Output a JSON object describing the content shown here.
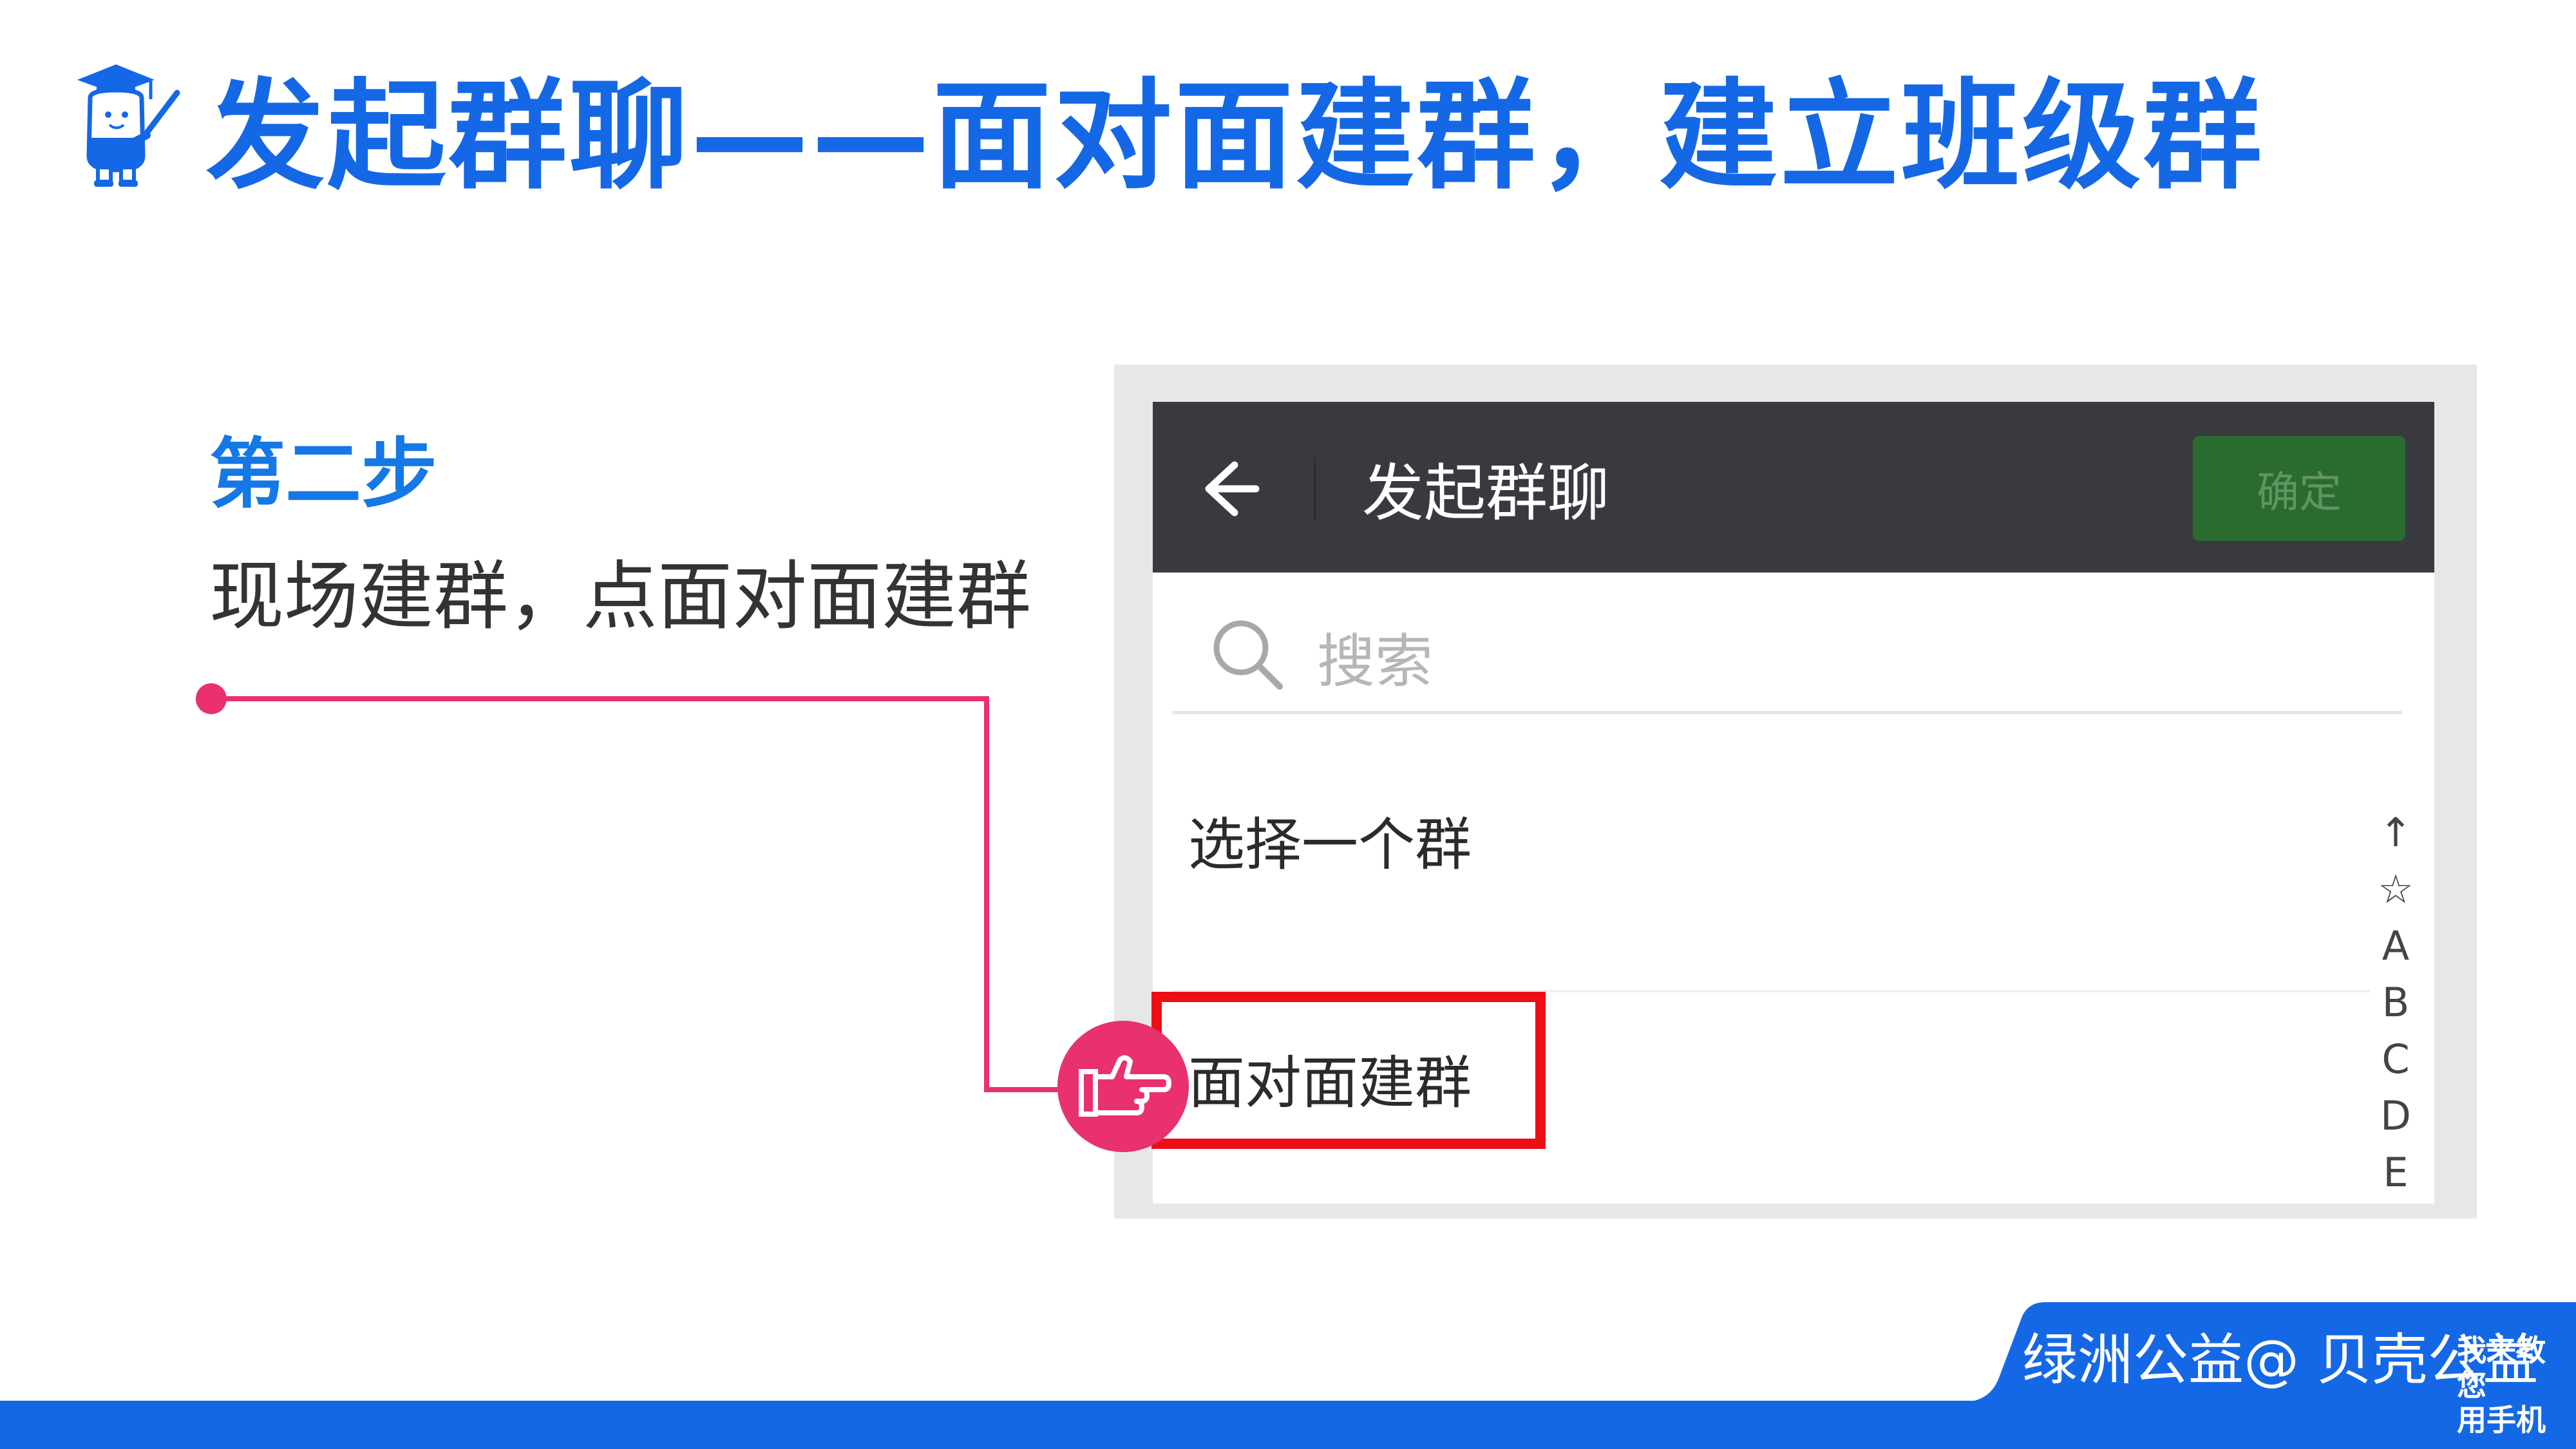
{
  "slide": {
    "title": "发起群聊——面对面建群，建立班级群",
    "step_title": "第二步",
    "step_description": "现场建群，点面对面建群"
  },
  "phone": {
    "appbar": {
      "back_icon": "arrow-left-icon",
      "title": "发起群聊",
      "confirm_label": "确定"
    },
    "search": {
      "icon": "search-icon",
      "placeholder": "搜索"
    },
    "list": {
      "items": [
        {
          "label": "选择一个群"
        },
        {
          "label": "面对面建群"
        }
      ]
    },
    "index_bar": [
      "↑",
      "☆",
      "A",
      "B",
      "C",
      "D",
      "E"
    ]
  },
  "footer": {
    "brand": "绿洲公益@ 贝壳公益",
    "slogan_line1": "我来教您",
    "slogan_line2": "用手机"
  },
  "colors": {
    "title_blue": "#1468e6",
    "highlight_red": "#ee0e15",
    "accent_pink": "#e9316e",
    "appbar_dark": "#393a3f",
    "confirm_green": "#2a6c30"
  }
}
